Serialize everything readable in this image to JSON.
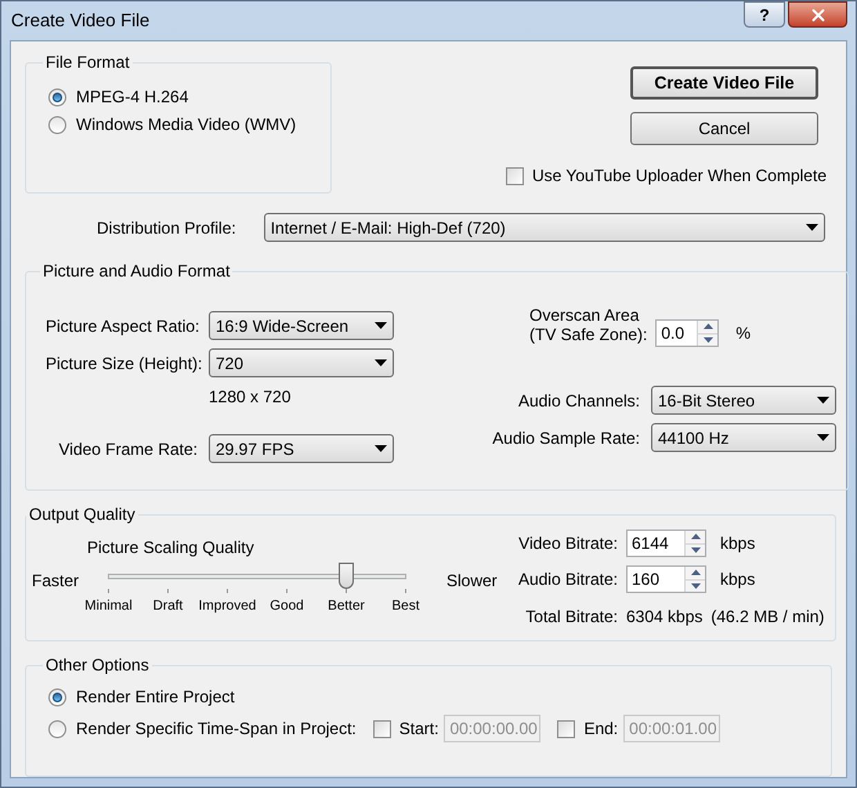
{
  "window": {
    "title": "Create Video File",
    "help": "?"
  },
  "file_format": {
    "title": "File Format",
    "options": [
      {
        "label": "MPEG-4 H.264",
        "selected": true
      },
      {
        "label": "Windows Media Video (WMV)",
        "selected": false
      }
    ]
  },
  "buttons": [
    {
      "label": "Create Video File",
      "default": true
    },
    {
      "label": "Cancel",
      "default": false
    }
  ],
  "youtube_uploader": {
    "label": "Use YouTube Uploader When Complete",
    "checked": false
  },
  "distribution_profile": {
    "label": "Distribution Profile:",
    "value": "Internet / E-Mail: High-Def (720)"
  },
  "picture_audio": {
    "title": "Picture and Audio Format",
    "aspect_ratio": {
      "label": "Picture Aspect Ratio:",
      "value": "16:9 Wide-Screen"
    },
    "picture_size": {
      "label": "Picture Size (Height):",
      "value": "720"
    },
    "resolution": "1280 x 720",
    "frame_rate": {
      "label": "Video Frame Rate:",
      "value": "29.97 FPS"
    },
    "overscan": {
      "label_line1": "Overscan Area",
      "label_line2": "(TV Safe Zone):",
      "value": "0.0",
      "unit": "%"
    },
    "audio_channels": {
      "label": "Audio Channels:",
      "value": "16-Bit Stereo"
    },
    "audio_sample_rate": {
      "label": "Audio Sample Rate:",
      "value": "44100 Hz"
    }
  },
  "output_quality": {
    "title": "Output Quality",
    "slider": {
      "title": "Picture Scaling Quality",
      "min_label": "Faster",
      "max_label": "Slower",
      "ticks": [
        "Minimal",
        "Draft",
        "Improved",
        "Good",
        "Better",
        "Best"
      ],
      "level": 0.8
    },
    "video_bitrate": {
      "label": "Video Bitrate:",
      "value": "6144",
      "unit": "kbps"
    },
    "audio_bitrate": {
      "label": "Audio Bitrate:",
      "value": "160",
      "unit": "kbps"
    },
    "total_bitrate": {
      "label": "Total Bitrate:",
      "value": "6304 kbps",
      "detail": "(46.2 MB / min)"
    }
  },
  "other_options": {
    "title": "Other Options",
    "options": [
      {
        "label": "Render Entire Project",
        "selected": true
      },
      {
        "label": "Render Specific Time-Span in Project:",
        "selected": false
      }
    ],
    "start": {
      "label": "Start:",
      "checked": false,
      "value": "00:00:00.00",
      "disabled": true
    },
    "end": {
      "label": "End:",
      "checked": false,
      "value": "00:00:01.00",
      "disabled": true
    }
  }
}
